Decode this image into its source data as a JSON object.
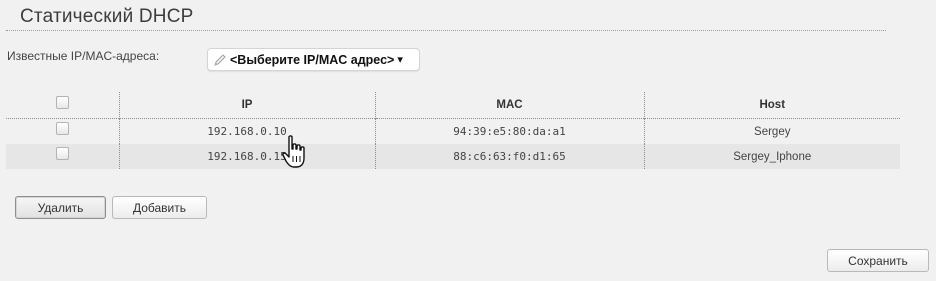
{
  "page": {
    "title": "Статический DHCP"
  },
  "known_addresses": {
    "label": "Известные IP/MAC-адреса:",
    "selected": "<Выберите IP/MAC адрес>",
    "caret": "▾"
  },
  "table": {
    "headers": {
      "ip": "IP",
      "mac": "MAC",
      "host": "Host"
    },
    "rows": [
      {
        "ip": "192.168.0.10",
        "mac": "94:39:e5:80:da:a1",
        "host": "Sergey"
      },
      {
        "ip": "192.168.0.15",
        "mac": "88:c6:63:f0:d1:65",
        "host": "Sergey_Iphone"
      }
    ]
  },
  "buttons": {
    "delete": "Удалить",
    "add": "Добавить",
    "save": "Сохранить"
  },
  "icons": {
    "select_icon": "pencil-icon",
    "dropdown": "caret-down-icon",
    "cursor": "hand-pointer-icon"
  },
  "colors": {
    "background": "#f1f1f1",
    "row_alt": "#e6e6e6"
  }
}
